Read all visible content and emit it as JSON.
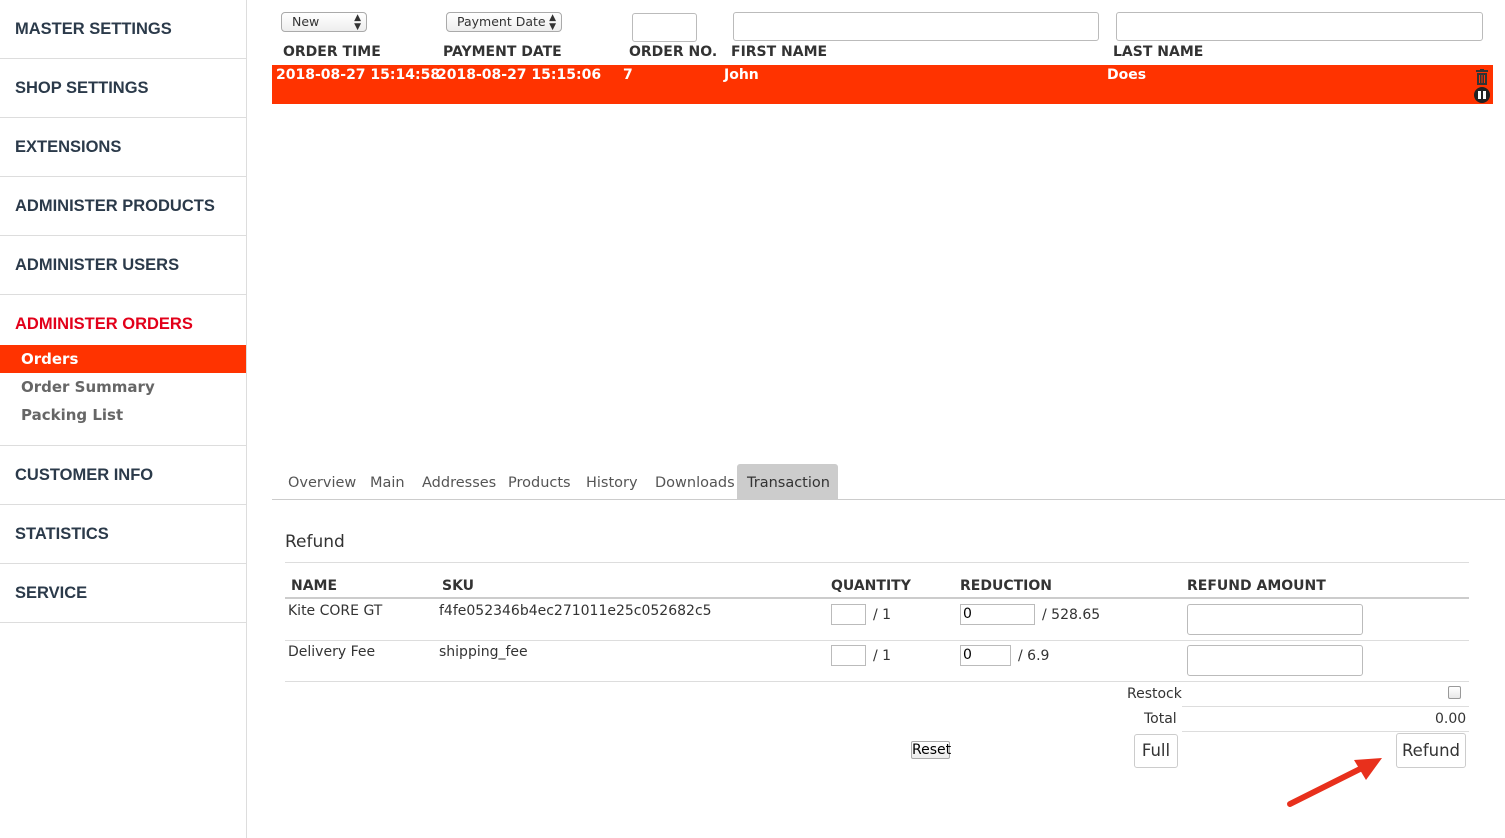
{
  "sidebar": {
    "sections": [
      {
        "label": "MASTER SETTINGS"
      },
      {
        "label": "SHOP SETTINGS"
      },
      {
        "label": "EXTENSIONS"
      },
      {
        "label": "ADMINISTER PRODUCTS"
      },
      {
        "label": "ADMINISTER USERS"
      },
      {
        "label": "ADMINISTER ORDERS",
        "active": true,
        "items": [
          {
            "label": "Orders",
            "active": true
          },
          {
            "label": "Order Summary"
          },
          {
            "label": "Packing List"
          }
        ]
      },
      {
        "label": "CUSTOMER INFO"
      },
      {
        "label": "STATISTICS"
      },
      {
        "label": "SERVICE"
      }
    ]
  },
  "filters": {
    "status_select": "New",
    "date_select": "Payment Date"
  },
  "columns": {
    "order_time": "ORDER TIME",
    "payment_date": "PAYMENT DATE",
    "order_no": "ORDER NO.",
    "first_name": "FIRST NAME",
    "last_name": "LAST NAME"
  },
  "order": {
    "order_time": "2018-08-27 15:14:58",
    "payment_date": "2018-08-27 15:15:06",
    "order_no": "7",
    "first_name": "John",
    "last_name": "Does"
  },
  "tabs": [
    "Overview",
    "Main",
    "Addresses",
    "Products",
    "History",
    "Downloads",
    "Transaction"
  ],
  "active_tab": "Transaction",
  "refund": {
    "title": "Refund",
    "headers": {
      "name": "NAME",
      "sku": "SKU",
      "quantity": "QUANTITY",
      "reduction": "REDUCTION",
      "refund_amount": "REFUND AMOUNT"
    },
    "rows": [
      {
        "name": "Kite CORE GT",
        "sku": "f4fe052346b4ec271011e25c052682c5",
        "qty_max": "/ 1",
        "reduction": "0",
        "reduction_max": "/ 528.65"
      },
      {
        "name": "Delivery Fee",
        "sku": "shipping_fee",
        "qty_max": "/ 1",
        "reduction": "0",
        "reduction_max": "/ 6.9"
      }
    ],
    "restock_label": "Restock",
    "total_label": "Total",
    "total_value": "0.00",
    "reset_label": "Reset",
    "full_label": "Full",
    "refund_label": "Refund"
  },
  "colors": {
    "accent": "#ff3300",
    "active_section": "#e2001a",
    "arrow": "#e8301c"
  }
}
